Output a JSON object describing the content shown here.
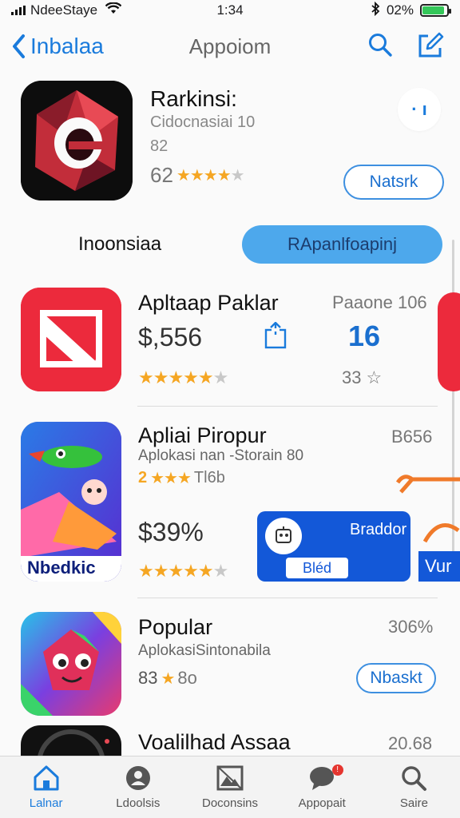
{
  "status_bar": {
    "carrier": "NdeeStaye",
    "time": "1:34",
    "battery": "02%",
    "battery_level": 0.9
  },
  "nav": {
    "back_label": "Inbalaa",
    "title": "Appoiom"
  },
  "featured": {
    "title": "Rarkinsi:",
    "subtitle": "Cidocnasiai 10",
    "number": "82",
    "rating_value": "62",
    "stars": 4,
    "more_label": "· ı",
    "button_label": "Natsrk"
  },
  "segment": {
    "label": "Inoonsiaa",
    "button_label": "RApanlfoapinj"
  },
  "apps": [
    {
      "title": "Apltaap Paklar",
      "price": "$,556",
      "right_top": "Paaone 106",
      "right_value": "16",
      "right_bottom": "33",
      "stars": 5
    },
    {
      "title": "Apliai Piropur",
      "subtitle": "Aplokasi nan -Storain 80",
      "rating": "2",
      "rating_note": "Tl6b",
      "price": "$39%",
      "right_top": "B656",
      "icon_caption": "Nbedkic",
      "card_title": "Braddor",
      "card_sub": "Bléd",
      "peek_label": "Vur",
      "stars": 5
    },
    {
      "title": "Popular",
      "subtitle": "AplokasiSintonabila",
      "rating": "83",
      "rating_note": "8o",
      "right_top": "306%",
      "button_label": "Nbaskt"
    },
    {
      "title": "Voalilhad Assaa",
      "right_top": "20.68"
    }
  ],
  "tabs": [
    {
      "label": "Lalnar",
      "icon": "home-icon"
    },
    {
      "label": "Ldoolsis",
      "icon": "person-circle-icon"
    },
    {
      "label": "Doconsins",
      "icon": "image-icon"
    },
    {
      "label": "Appopait",
      "icon": "chat-icon"
    },
    {
      "label": "Saire",
      "icon": "search-icon"
    }
  ],
  "colors": {
    "accent": "#1a7bdc",
    "star": "#f5a623",
    "segment_bg": "#4da8ec"
  }
}
